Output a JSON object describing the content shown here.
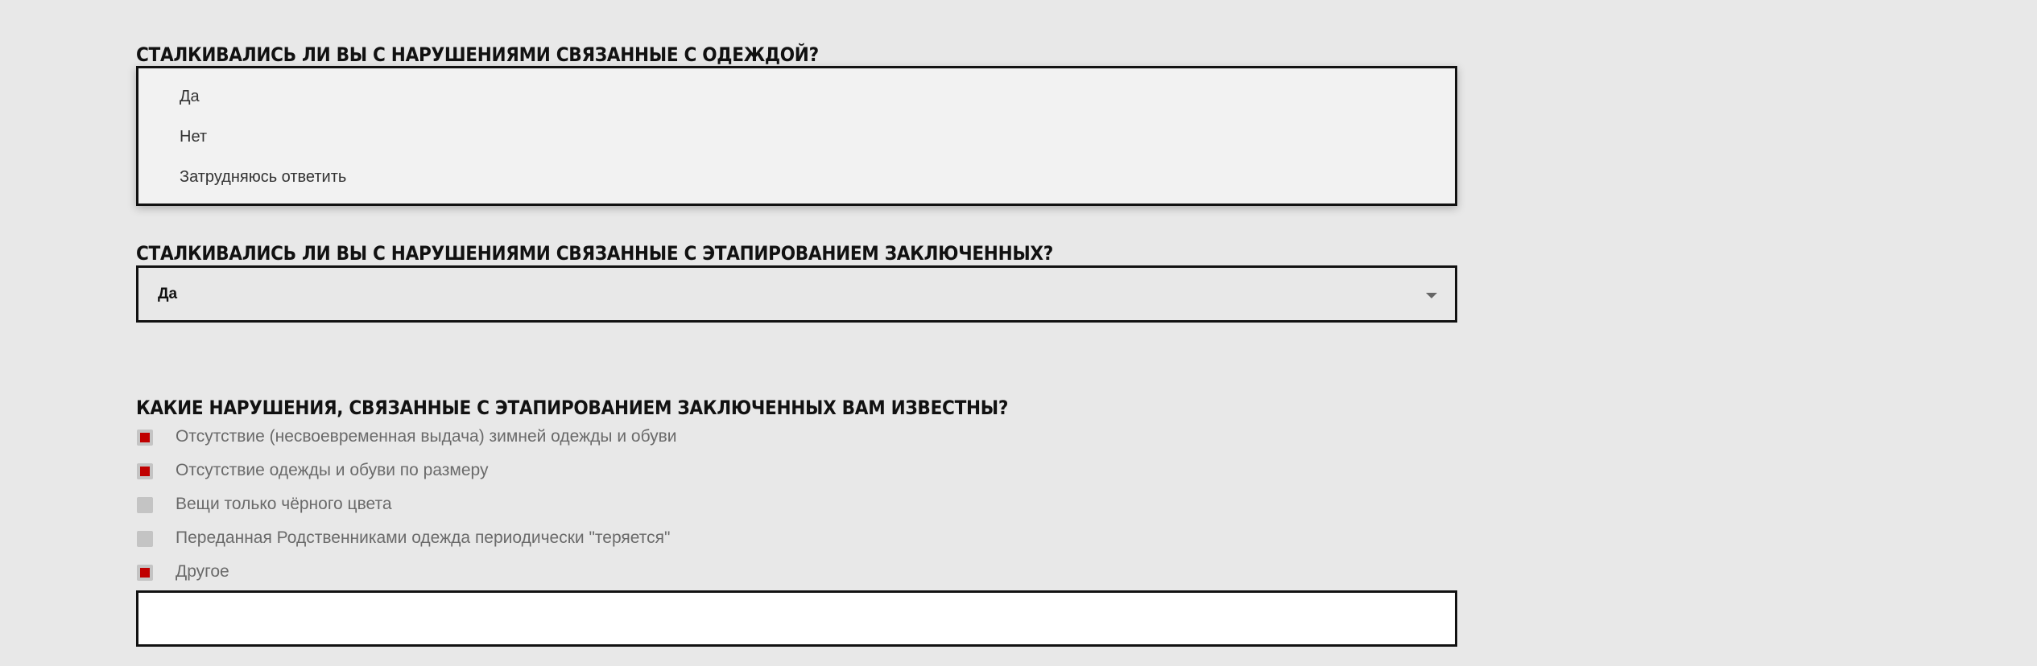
{
  "question1": {
    "title": "СТАЛКИВАЛИСЬ ЛИ ВЫ С НАРУШЕНИЯМИ СВЯЗАННЫЕ С ОДЕЖДОЙ?",
    "options": [
      "Да",
      "Нет",
      "Затрудняюсь ответить"
    ]
  },
  "question2": {
    "title": "СТАЛКИВАЛИСЬ ЛИ ВЫ С НАРУШЕНИЯМИ СВЯЗАННЫЕ С ЭТАПИРОВАНИЕМ ЗАКЛЮЧЕННЫХ?",
    "selected": "Да",
    "caret_icon": "chevron-down-icon"
  },
  "question3": {
    "title": "КАКИЕ НАРУШЕНИЯ, СВЯЗАННЫЕ С ЭТАПИРОВАНИЕМ ЗАКЛЮЧЕННЫХ ВАМ ИЗВЕСТНЫ?",
    "options": [
      {
        "label": "Отсутствие (несвоевременная выдача) зимней одежды и обуви",
        "checked": true
      },
      {
        "label": "Отсутствие одежды и обуви по размеру",
        "checked": true
      },
      {
        "label": "Вещи только чёрного цвета",
        "checked": false
      },
      {
        "label": "Переданная Родственниками одежда периодически \"теряется\"",
        "checked": false
      },
      {
        "label": "Другое",
        "checked": true
      }
    ],
    "other_value": ""
  },
  "colors": {
    "background": "#e8e8e8",
    "checked_accent": "#c00000",
    "border": "#111111"
  }
}
